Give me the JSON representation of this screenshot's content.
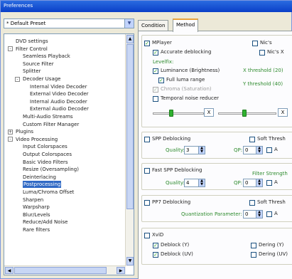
{
  "window": {
    "title": "Preferences"
  },
  "preset": {
    "value": "* Default Preset"
  },
  "tree": {
    "items": [
      {
        "label": "DVD settings",
        "indent": 0,
        "toggle": ""
      },
      {
        "label": "Filter Control",
        "indent": 0,
        "toggle": "-"
      },
      {
        "label": "Seamless Playback",
        "indent": 1,
        "toggle": ""
      },
      {
        "label": "Source Filter",
        "indent": 1,
        "toggle": ""
      },
      {
        "label": "Splitter",
        "indent": 1,
        "toggle": ""
      },
      {
        "label": "Decoder Usage",
        "indent": 1,
        "toggle": "-"
      },
      {
        "label": "Internal Video Decoder",
        "indent": 2,
        "toggle": ""
      },
      {
        "label": "External Video Decoder",
        "indent": 2,
        "toggle": ""
      },
      {
        "label": "Internal Audio Decoder",
        "indent": 2,
        "toggle": ""
      },
      {
        "label": "External Audio Decoder",
        "indent": 2,
        "toggle": ""
      },
      {
        "label": "Multi-Audio Streams",
        "indent": 1,
        "toggle": ""
      },
      {
        "label": "Custom Filter Manager",
        "indent": 1,
        "toggle": ""
      },
      {
        "label": "Plugins",
        "indent": 0,
        "toggle": "+"
      },
      {
        "label": "Video Processing",
        "indent": 0,
        "toggle": "-"
      },
      {
        "label": "Input Colorspaces",
        "indent": 1,
        "toggle": ""
      },
      {
        "label": "Output Colorspaces",
        "indent": 1,
        "toggle": ""
      },
      {
        "label": "Basic Video Filters",
        "indent": 1,
        "toggle": ""
      },
      {
        "label": "Resize (Oversampling)",
        "indent": 1,
        "toggle": ""
      },
      {
        "label": "Deinterlacing",
        "indent": 1,
        "toggle": ""
      },
      {
        "label": "Postprocessing",
        "indent": 1,
        "toggle": "",
        "selected": true
      },
      {
        "label": "Luma/Chroma Offset",
        "indent": 1,
        "toggle": ""
      },
      {
        "label": "Sharpen",
        "indent": 1,
        "toggle": ""
      },
      {
        "label": "Warpsharp",
        "indent": 1,
        "toggle": ""
      },
      {
        "label": "Blur/Levels",
        "indent": 1,
        "toggle": ""
      },
      {
        "label": "Reduce/Add Noise",
        "indent": 1,
        "toggle": ""
      },
      {
        "label": "Rare filters",
        "indent": 1,
        "toggle": ""
      }
    ]
  },
  "tabs": [
    {
      "label": "Condition"
    },
    {
      "label": "Method"
    }
  ],
  "method": {
    "mplayer": {
      "label": "MPlayer",
      "checked": true
    },
    "nics": {
      "label": "Nic's",
      "checked": false
    },
    "accurate_deblocking": {
      "label": "Accurate deblocking",
      "checked": true
    },
    "nics_x": {
      "label": "Nic's X",
      "checked": false
    },
    "levelfix": {
      "label": "Levelfix:"
    },
    "luminance": {
      "label": "Luminance (Brightness)",
      "checked": true
    },
    "x_threshold": {
      "label": "X threshold (20)"
    },
    "full_luma": {
      "label": "Full luma range",
      "checked": true
    },
    "y_threshold": {
      "label": "Y threshold (40)"
    },
    "chroma": {
      "label": "Chroma (Saturation)",
      "checked": true,
      "disabled": true
    },
    "temporal": {
      "label": "Temporal noise reducer",
      "checked": false
    },
    "slider1_box": "X",
    "slider2_box": "X",
    "slider1_level": 0.35,
    "slider2_level": 0.45
  },
  "spp": {
    "label": "SPP Deblocking",
    "checked": false,
    "soft_label": "Soft Thresh",
    "soft_checked": false,
    "quality_label": "Quality:",
    "quality_value": "3",
    "qp_label": "QP:",
    "qp_value": "0",
    "a_label": "A"
  },
  "fast_spp": {
    "label": "Fast SPP Deblocking",
    "checked": false,
    "filter_strength": "Filter Strength",
    "quality_label": "Quality:",
    "quality_value": "4",
    "qp_label": "QP:",
    "qp_value": "0",
    "a_label": "A"
  },
  "pp7": {
    "label": "PP7 Deblocking",
    "checked": false,
    "soft_label": "Soft Thresh",
    "soft_checked": false,
    "quant_label": "Quantization Parameter:",
    "quant_value": "0",
    "a_label": "A"
  },
  "xvid": {
    "label": "XviD",
    "checked": false,
    "deblock_y": {
      "label": "Deblock (Y)",
      "checked": true
    },
    "dering_y": {
      "label": "Dering (Y)",
      "checked": false
    },
    "deblock_uv": {
      "label": "Deblock (UV)",
      "checked": true
    },
    "dering_uv": {
      "label": "Dering (UV)",
      "checked": false
    }
  },
  "colors": {
    "accent": "#316ac5",
    "green_label": "#2e8b2e",
    "tab_highlight": "#e8a33c"
  }
}
